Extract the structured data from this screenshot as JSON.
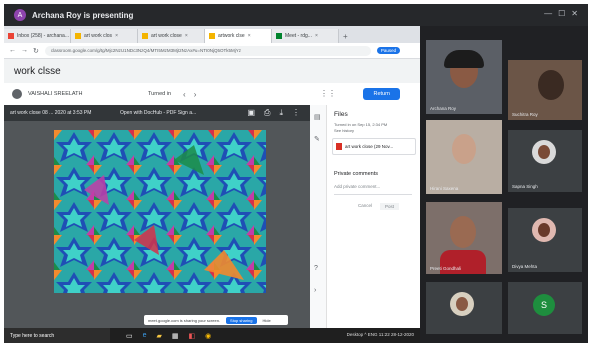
{
  "meet": {
    "presenter_initial": "A",
    "presenting_label": "Archana Roy is presenting"
  },
  "browser": {
    "tabs": [
      {
        "label": "Inbox (258) - archana..."
      },
      {
        "label": "art work clos"
      },
      {
        "label": "art work close"
      },
      {
        "label": "artwork clse"
      },
      {
        "label": "Meet - rdg..."
      }
    ],
    "url": "classroom.google.com/g/tg/Mjc2NzU1NDc3NzQ4/MTI5MzM3MjI2NzAx#u=NTI0NjQ5OTk5MjYz",
    "paused_label": "Paused"
  },
  "classroom": {
    "assignment_title": "work clsse",
    "student_name": "VAISHALI SREELATH",
    "turned_in": "Turned in",
    "return_label": "Return"
  },
  "viewer": {
    "file_label": "art work close 08 ... 2020 at 3:53 PM",
    "open_with": "Open with DocHub - PDF Sign a...",
    "share_banner": "meet.google.com is sharing your screen.",
    "stop_sharing": "Stop sharing",
    "hide": "Hide"
  },
  "files_panel": {
    "heading": "Files",
    "turned_in_info": "Turned in on Sep 15, 2:34 PM",
    "see_history": "See history",
    "file_name": "art work close (29 Nov...",
    "private_heading": "Private comments",
    "comment_placeholder": "Add private comment...",
    "cancel": "Cancel",
    "post": "Post"
  },
  "taskbar": {
    "search": "Type here to search",
    "tray": "Desktop ^ ENG 11:22 28-12-2020"
  },
  "participants": [
    {
      "name": "Archana Roy"
    },
    {
      "name": "Suchitra Roy"
    },
    {
      "name": "Hirani Saxena"
    },
    {
      "name": "Sapna Singh"
    },
    {
      "name": "Preeti Gondhali"
    },
    {
      "name": "Divya Mehta"
    }
  ],
  "self_avatar": "S",
  "colors": {
    "meet_dark": "#202124",
    "accent_blue": "#1a73e8",
    "self_avatar_green": "#1e8e3e"
  }
}
